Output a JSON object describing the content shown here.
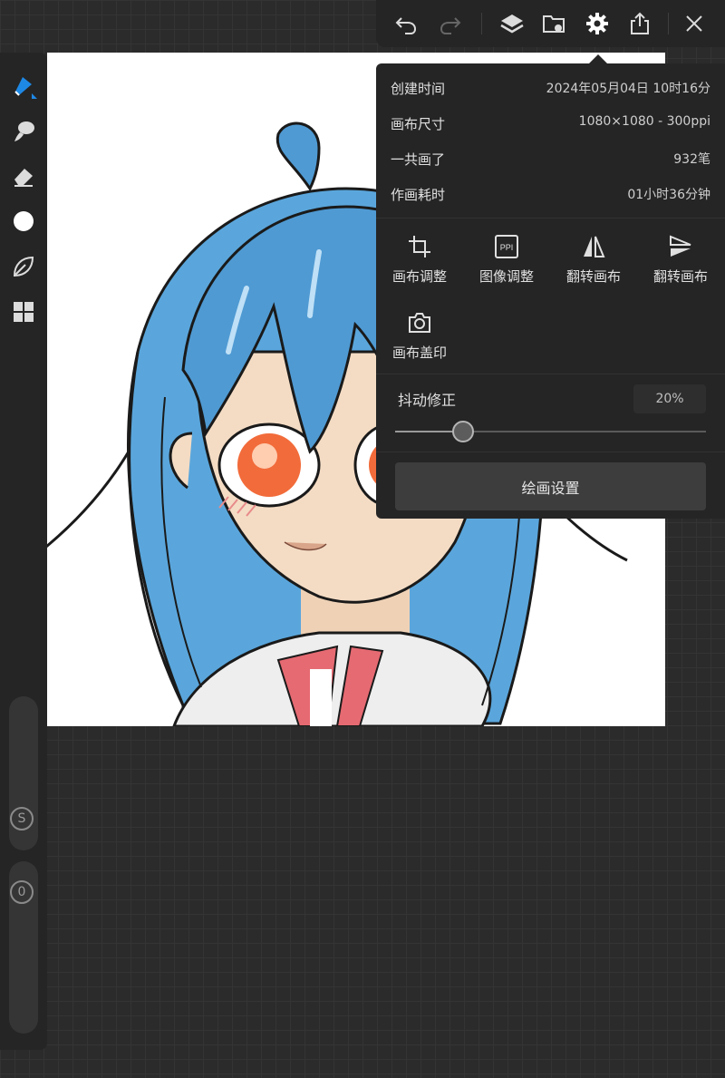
{
  "toolbar": {
    "undo_icon": "undo-icon",
    "redo_icon": "redo-icon",
    "layers_icon": "layers-icon",
    "gallery_icon": "image-folder-icon",
    "settings_icon": "gear-icon",
    "share_icon": "share-icon",
    "close_icon": "close-icon"
  },
  "sidebar": {
    "tools": [
      "pen-icon",
      "brush-icon",
      "eraser-icon",
      "color-dot-icon",
      "leaf-icon",
      "grid-icon"
    ],
    "active_color": "#1e88e5",
    "size_slider_label": "S",
    "opacity_slider_label": "0"
  },
  "info": {
    "created_label": "创建时间",
    "created_value": "2024年05月04日 10时16分",
    "size_label": "画布尺寸",
    "size_value": "1080×1080 - 300ppi",
    "strokes_label": "一共画了",
    "strokes_value": "932笔",
    "duration_label": "作画耗时",
    "duration_value": "01小时36分钟"
  },
  "actions": [
    {
      "label": "画布调整",
      "icon": "crop-icon"
    },
    {
      "label": "图像调整",
      "icon": "ppi-icon"
    },
    {
      "label": "翻转画布",
      "icon": "flip-horizontal-icon"
    },
    {
      "label": "翻转画布",
      "icon": "flip-vertical-icon"
    },
    {
      "label": "画布盖印",
      "icon": "camera-icon"
    }
  ],
  "ppi_text": "PPI",
  "stabilizer": {
    "label": "抖动修正",
    "value": "20%",
    "fraction": 0.22
  },
  "draw_settings_label": "绘画设置",
  "colors": {
    "panel_bg": "#252525",
    "hair": "#5aa6dc",
    "skin": "#f4dcc4",
    "eyes": "#f26b3a"
  }
}
